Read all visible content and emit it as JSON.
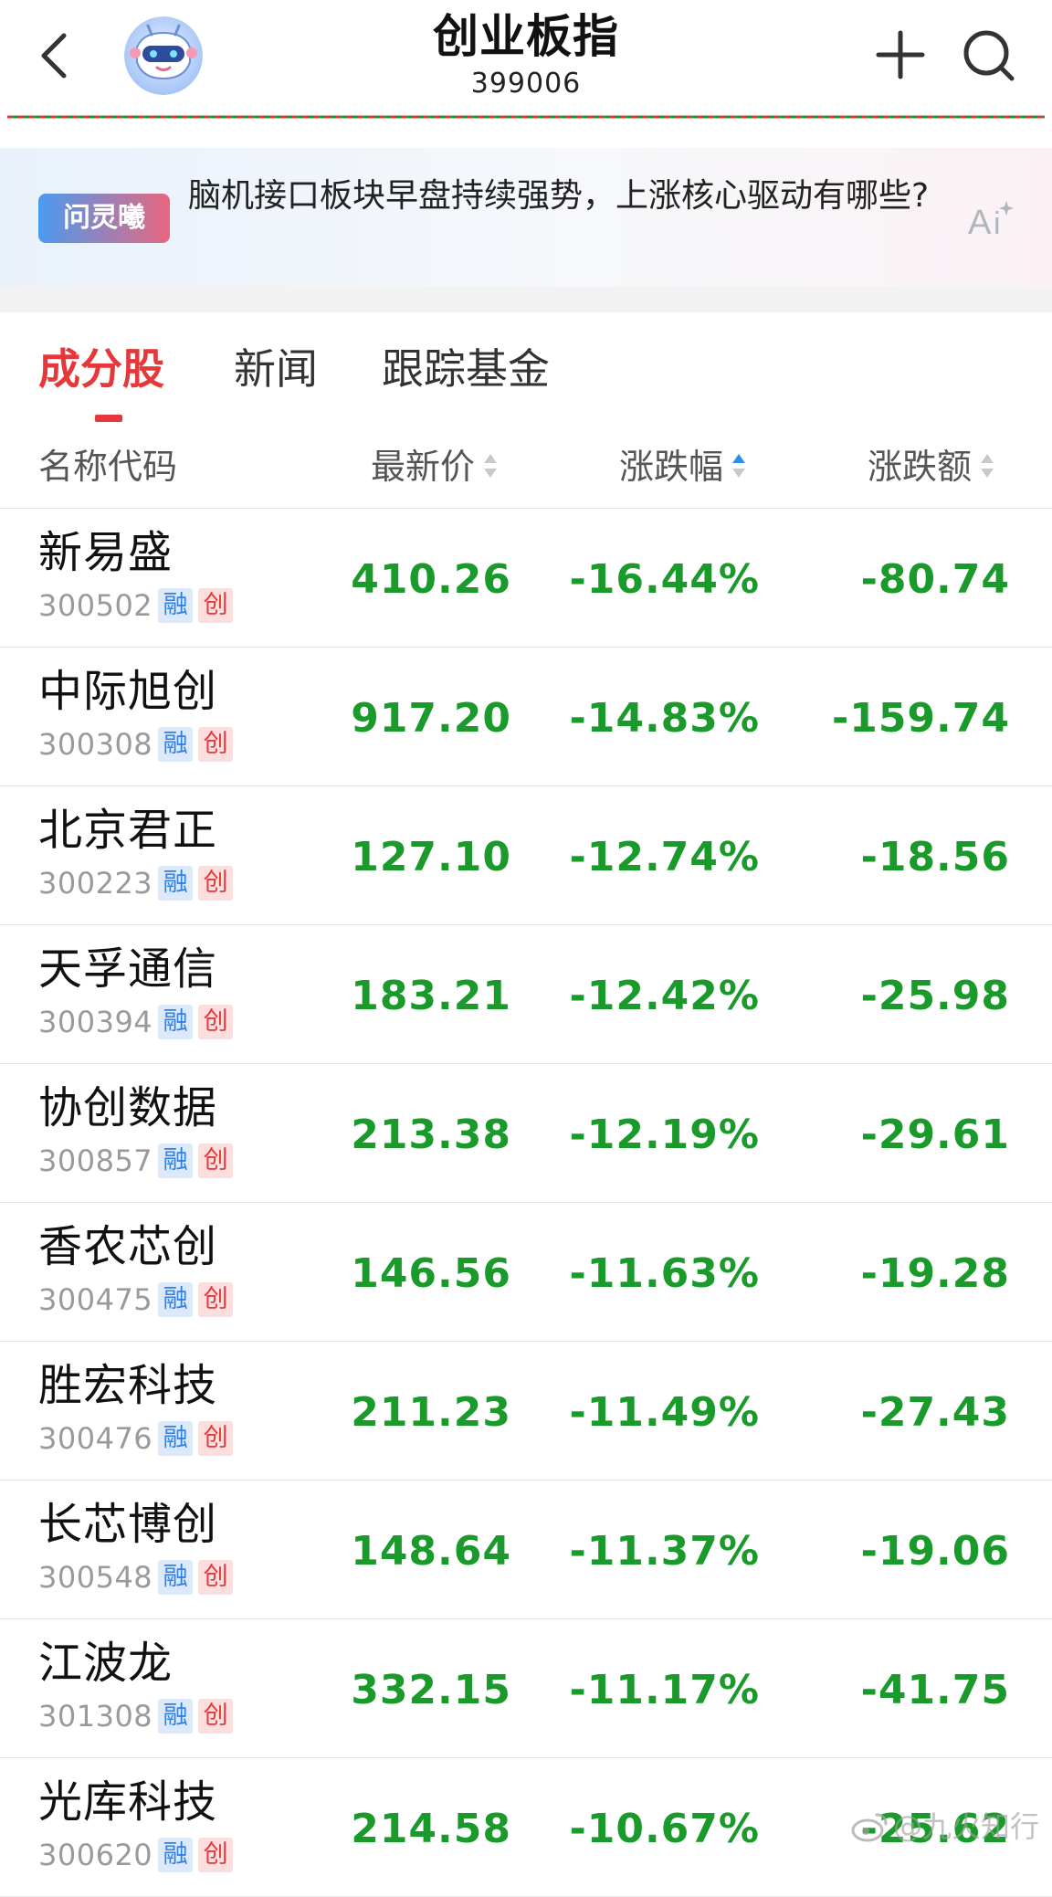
{
  "header": {
    "title": "创业板指",
    "code": "399006",
    "back_icon": "chevron-left-icon",
    "avatar_icon": "robot-avatar-icon",
    "add_icon": "plus-icon",
    "search_icon": "search-icon",
    "dash_colors": [
      "#e5383b",
      "#1a9a2a"
    ]
  },
  "ai_banner": {
    "badge": "问灵曦",
    "question": "脑机接口板块早盘持续强势，上涨核心驱动有哪些?",
    "icon": "ai-sparkle-icon"
  },
  "tabs": [
    {
      "label": "成分股",
      "active": true
    },
    {
      "label": "新闻",
      "active": false
    },
    {
      "label": "跟踪基金",
      "active": false
    }
  ],
  "columns": {
    "name": "名称代码",
    "price": "最新价",
    "pct": "涨跌幅",
    "change": "涨跌额"
  },
  "tags": {
    "rong": "融",
    "chuang": "创"
  },
  "rows": [
    {
      "name": "新易盛",
      "code": "300502",
      "price": "410.26",
      "pct": "-16.44%",
      "change": "-80.74"
    },
    {
      "name": "中际旭创",
      "code": "300308",
      "price": "917.20",
      "pct": "-14.83%",
      "change": "-159.74"
    },
    {
      "name": "北京君正",
      "code": "300223",
      "price": "127.10",
      "pct": "-12.74%",
      "change": "-18.56"
    },
    {
      "name": "天孚通信",
      "code": "300394",
      "price": "183.21",
      "pct": "-12.42%",
      "change": "-25.98"
    },
    {
      "name": "协创数据",
      "code": "300857",
      "price": "213.38",
      "pct": "-12.19%",
      "change": "-29.61"
    },
    {
      "name": "香农芯创",
      "code": "300475",
      "price": "146.56",
      "pct": "-11.63%",
      "change": "-19.28"
    },
    {
      "name": "胜宏科技",
      "code": "300476",
      "price": "211.23",
      "pct": "-11.49%",
      "change": "-27.43"
    },
    {
      "name": "长芯博创",
      "code": "300548",
      "price": "148.64",
      "pct": "-11.37%",
      "change": "-19.06"
    },
    {
      "name": "江波龙",
      "code": "301308",
      "price": "332.15",
      "pct": "-11.17%",
      "change": "-41.75"
    },
    {
      "name": "光库科技",
      "code": "300620",
      "price": "214.58",
      "pct": "-10.67%",
      "change": "-25.62"
    }
  ],
  "colors": {
    "down": "#1a9a2a",
    "accent_red": "#e5383b",
    "accent_blue": "#2f8fe8"
  },
  "watermark": "@九火知行"
}
